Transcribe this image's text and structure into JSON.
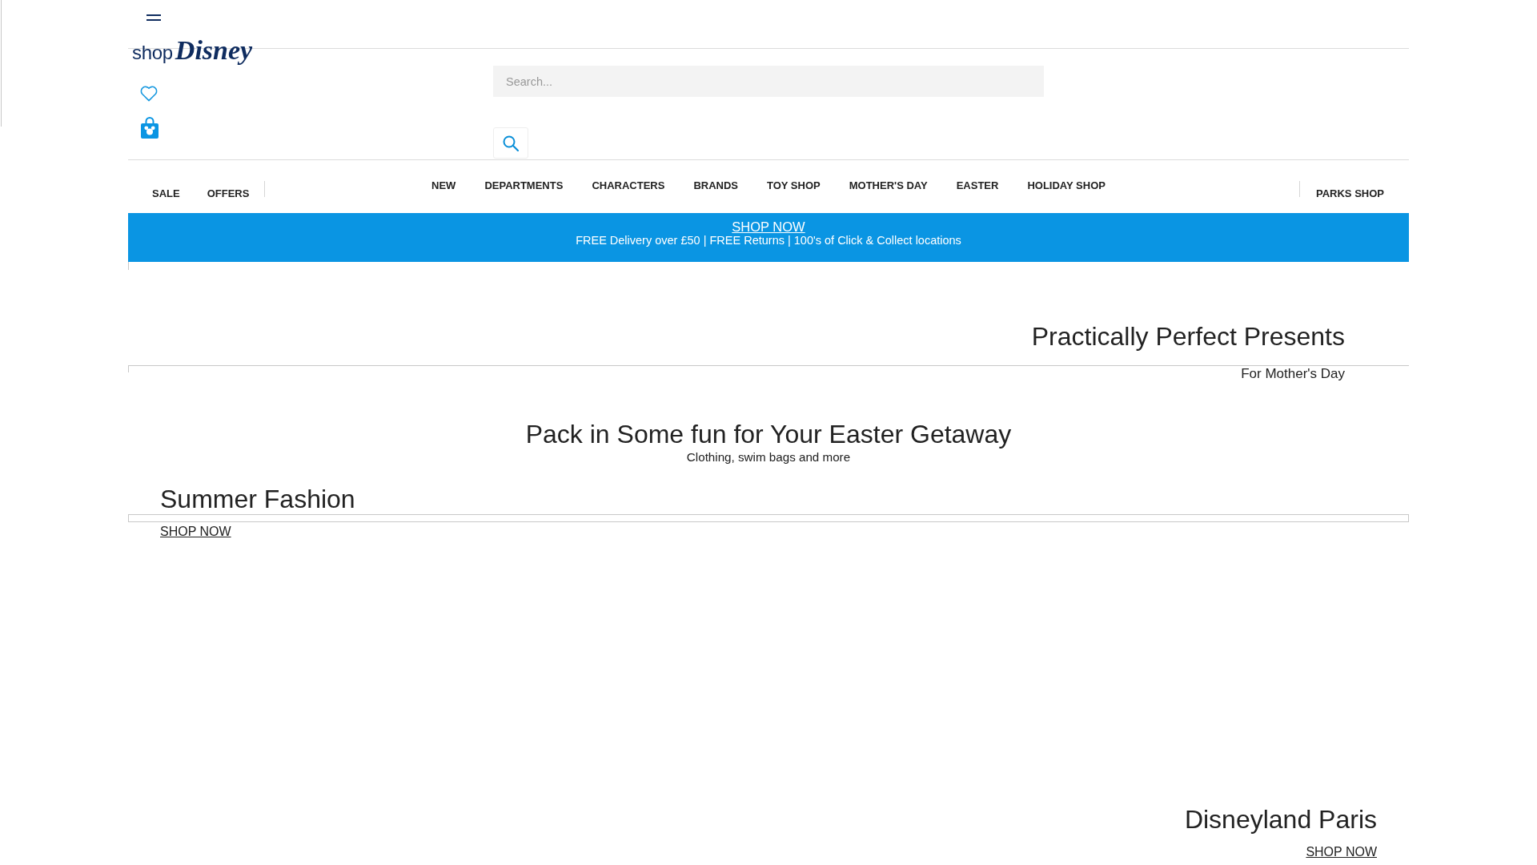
{
  "logo": {
    "prefix": "shop",
    "wordmark": "Disney"
  },
  "search": {
    "placeholder": "Search..."
  },
  "nav": {
    "left": [
      "SALE",
      "OFFERS"
    ],
    "main": [
      "NEW",
      "DEPARTMENTS",
      "CHARACTERS",
      "BRANDS",
      "TOY SHOP",
      "MOTHER'S DAY",
      "EASTER",
      "HOLIDAY SHOP"
    ],
    "right": [
      "PARKS SHOP"
    ]
  },
  "banner": {
    "link": "SHOP NOW",
    "text": "FREE Delivery over £50 | FREE Returns | 100's of Click & Collect locations"
  },
  "promos": [
    {
      "kind": "right-hero",
      "title": "Practically Perfect Presents",
      "subtitle": "For Mother's Day"
    },
    {
      "kind": "centered",
      "title": "Pack in Some fun for Your Easter Getaway",
      "subtitle": "Clothing, swim bags and more"
    },
    {
      "kind": "left-feature",
      "title": "Summer Fashion",
      "link": "SHOP NOW"
    },
    {
      "kind": "right-feature",
      "title": "Disneyland Paris",
      "link": "SHOP NOW"
    }
  ]
}
